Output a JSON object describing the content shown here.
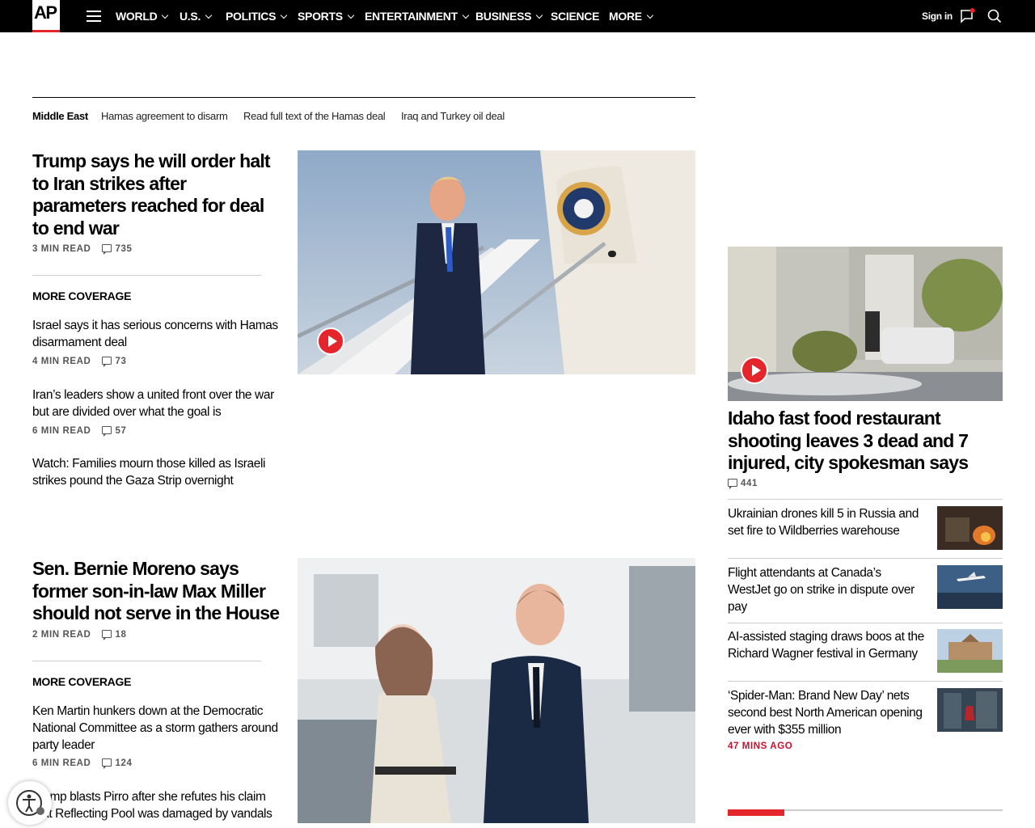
{
  "nav": {
    "logo": "AP",
    "items": [
      "WORLD",
      "U.S.",
      "POLITICS",
      "SPORTS",
      "ENTERTAINMENT",
      "BUSINESS",
      "SCIENCE",
      "MORE"
    ],
    "signin": "Sign in"
  },
  "topics": [
    "Middle East",
    "Hamas agreement to disarm",
    "Read full text of the Hamas deal",
    "Iraq and Turkey oil deal"
  ],
  "story1": {
    "headline": "Trump says he will order halt to Iran strikes after parameters reached for deal to end war",
    "read": "3 MIN READ",
    "comments": "735",
    "more_label": "MORE COVERAGE",
    "related": [
      {
        "title": "Israel says it has serious concerns with Hamas disarmament deal",
        "read": "4 MIN READ",
        "comments": "73"
      },
      {
        "title": "Iran’s leaders show a united front over the war but are divided over what the goal is",
        "read": "6 MIN READ",
        "comments": "57"
      },
      {
        "title": "Watch: Families mourn those killed as Israeli strikes pound the Gaza Strip overnight"
      }
    ]
  },
  "story2": {
    "headline": "Sen. Bernie Moreno says former son-in-law Max Miller should not serve in the House",
    "read": "2 MIN READ",
    "comments": "18",
    "more_label": "MORE COVERAGE",
    "related": [
      {
        "title": "Ken Martin hunkers down at the Democratic National Committee as a storm gathers around party leader",
        "read": "6 MIN READ",
        "comments": "124"
      },
      {
        "title": "Trump blasts Pirro after she refutes his claim that Reflecting Pool was damaged by vandals"
      }
    ]
  },
  "side": {
    "lead": {
      "headline": "Idaho fast food restaurant shooting leaves 3 dead and 7 injured, city spokesman says",
      "comments": "441"
    },
    "items": [
      {
        "title": "Ukrainian drones kill 5 in Russia and set fire to Wildberries warehouse"
      },
      {
        "title": "Flight attendants at Canada’s WestJet go on strike in dispute over pay"
      },
      {
        "title": "AI-assisted staging draws boos at the Richard Wagner festival in Germany"
      },
      {
        "title": "‘Spider-Man: Brand New Day’ nets second best North American opening ever with $355 million",
        "ago": "47 MINS AGO"
      }
    ]
  },
  "colors": {
    "brand_red": "#e4262c",
    "nav_bg": "#000000"
  }
}
